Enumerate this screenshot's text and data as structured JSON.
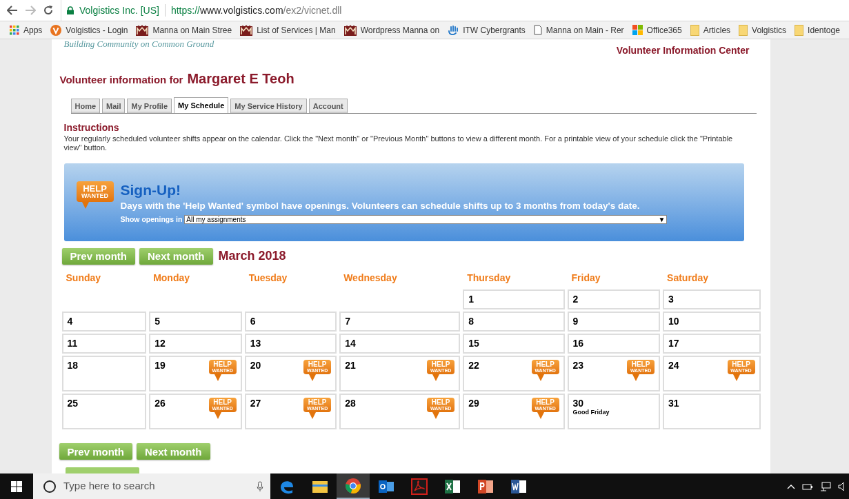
{
  "browser": {
    "site_identity": "Volgistics Inc. [US]",
    "url_scheme": "https://",
    "url_host": "www.volgistics.com",
    "url_path": "/ex2/vicnet.dll",
    "bookmarks": [
      {
        "kind": "apps",
        "label": "Apps"
      },
      {
        "kind": "v",
        "label": "Volgistics - Login"
      },
      {
        "kind": "manna",
        "label": "Manna on Main Stree"
      },
      {
        "kind": "manna",
        "label": "List of Services | Man"
      },
      {
        "kind": "manna",
        "label": "Wordpress Manna on"
      },
      {
        "kind": "hand",
        "label": "ITW Cybergrants"
      },
      {
        "kind": "page",
        "label": "Manna on Main - Rer"
      },
      {
        "kind": "office",
        "label": "Office365"
      },
      {
        "kind": "folder",
        "label": "Articles"
      },
      {
        "kind": "folder",
        "label": "Volgistics"
      },
      {
        "kind": "folder",
        "label": "Identoge"
      }
    ]
  },
  "page": {
    "tagline": "Building Community on Common Ground",
    "center_title": "Volunteer Information Center",
    "info_label": "Volunteer information for",
    "volunteer_name": "Margaret E Teoh",
    "tabs": [
      {
        "label": "Home",
        "selected": false
      },
      {
        "label": "Mail",
        "selected": false
      },
      {
        "label": "My Profile",
        "selected": false
      },
      {
        "label": "My Schedule",
        "selected": true
      },
      {
        "label": "My Service History",
        "selected": false
      },
      {
        "label": "Account",
        "selected": false
      }
    ],
    "instructions_title": "Instructions",
    "instructions_text": "Your regularly scheduled volunteer shifts appear on the calendar. Click the \"Next month\" or \"Previous Month\" buttons to view a different month. For a printable view of your schedule click the \"Printable view\" button.",
    "signup": {
      "badge": [
        "HELP",
        "WANTED"
      ],
      "title": "Sign-Up!",
      "text": "Days with the 'Help Wanted' symbol have openings. Volunteers can schedule shifts up to 3 months from today's date.",
      "select_label": "Show openings in",
      "select_value": "All my assignments",
      "select_arrow": "▼"
    },
    "nav_buttons": [
      "Prev month",
      "Next month"
    ],
    "month": "March 2018",
    "weekdays": [
      "Sunday",
      "Monday",
      "Tuesday",
      "Wednesday",
      "Thursday",
      "Friday",
      "Saturday"
    ],
    "cells": [
      {
        "kind": "blank"
      },
      {
        "kind": "blank"
      },
      {
        "kind": "blank"
      },
      {
        "kind": "blank"
      },
      {
        "kind": "day",
        "day": "1"
      },
      {
        "kind": "day",
        "day": "2"
      },
      {
        "kind": "day",
        "day": "3"
      },
      {
        "kind": "day",
        "day": "4"
      },
      {
        "kind": "day",
        "day": "5"
      },
      {
        "kind": "day",
        "day": "6"
      },
      {
        "kind": "day",
        "day": "7"
      },
      {
        "kind": "day",
        "day": "8"
      },
      {
        "kind": "day",
        "day": "9"
      },
      {
        "kind": "day",
        "day": "10"
      },
      {
        "kind": "day",
        "day": "11"
      },
      {
        "kind": "day",
        "day": "12"
      },
      {
        "kind": "day",
        "day": "13"
      },
      {
        "kind": "day",
        "day": "14"
      },
      {
        "kind": "day",
        "day": "15"
      },
      {
        "kind": "day",
        "day": "16"
      },
      {
        "kind": "day",
        "day": "17"
      },
      {
        "kind": "day",
        "day": "18"
      },
      {
        "kind": "day",
        "day": "19",
        "badge": [
          "HELP",
          "WANTED"
        ]
      },
      {
        "kind": "day",
        "day": "20",
        "badge": [
          "HELP",
          "WANTED"
        ]
      },
      {
        "kind": "day",
        "day": "21",
        "badge": [
          "HELP",
          "WANTED"
        ]
      },
      {
        "kind": "day",
        "day": "22",
        "badge": [
          "HELP",
          "WANTED"
        ]
      },
      {
        "kind": "day",
        "day": "23",
        "badge": [
          "HELP",
          "WANTED"
        ]
      },
      {
        "kind": "day",
        "day": "24",
        "badge": [
          "HELP",
          "WANTED"
        ]
      },
      {
        "kind": "day",
        "day": "25"
      },
      {
        "kind": "day",
        "day": "26",
        "badge": [
          "HELP",
          "WANTED"
        ]
      },
      {
        "kind": "day",
        "day": "27",
        "badge": [
          "HELP",
          "WANTED"
        ]
      },
      {
        "kind": "day",
        "day": "28",
        "badge": [
          "HELP",
          "WANTED"
        ]
      },
      {
        "kind": "day",
        "day": "29",
        "badge": [
          "HELP",
          "WANTED"
        ]
      },
      {
        "kind": "day",
        "day": "30",
        "note": "Good Friday"
      },
      {
        "kind": "day",
        "day": "31"
      }
    ],
    "bottom_buttons": [
      "Prev month",
      "Next month"
    ]
  },
  "taskbar": {
    "search_placeholder": "Type here to search",
    "apps": [
      {
        "kind": "edge",
        "selected": false
      },
      {
        "kind": "explorer",
        "selected": false
      },
      {
        "kind": "chrome",
        "selected": true
      },
      {
        "kind": "outlook",
        "selected": false
      },
      {
        "kind": "acrobat",
        "selected": false
      },
      {
        "kind": "excel",
        "selected": false
      },
      {
        "kind": "powerpoint",
        "selected": false
      },
      {
        "kind": "word",
        "selected": false
      }
    ]
  }
}
